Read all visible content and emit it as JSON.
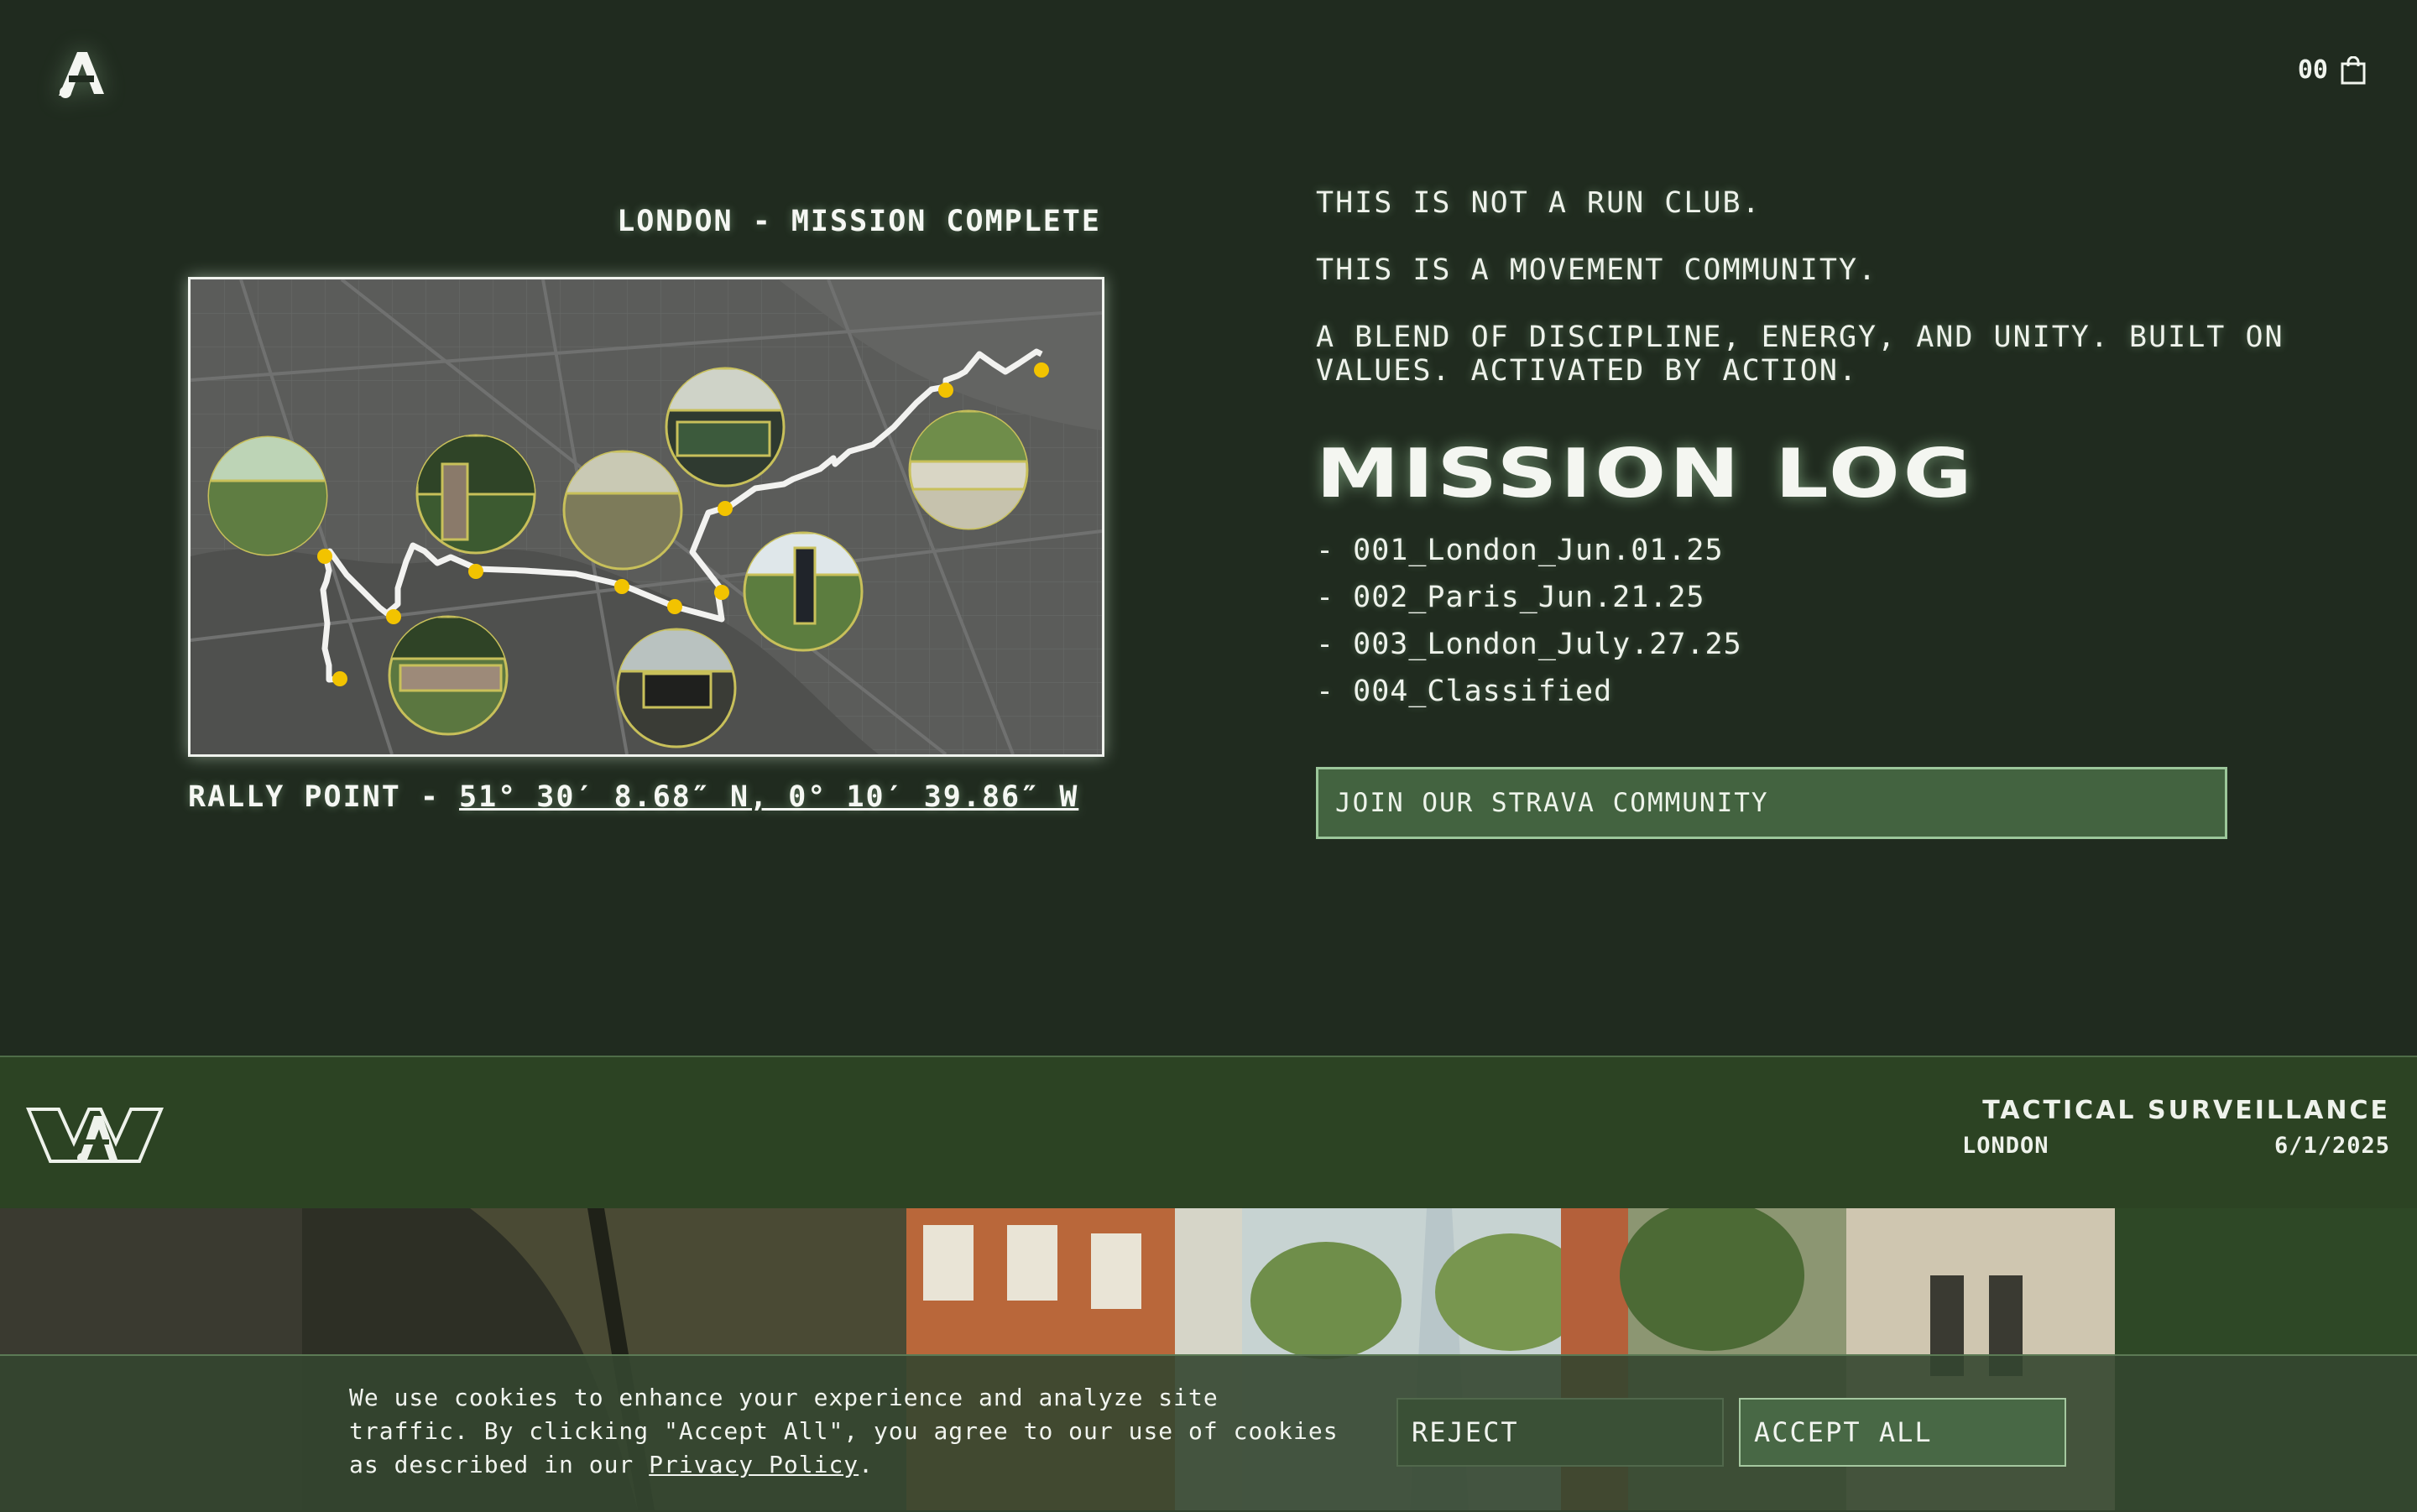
{
  "header": {
    "logo_icon": "brand-a-logo",
    "cart_count": "00",
    "cart_icon": "shopping-bag-icon"
  },
  "mission": {
    "title": "LONDON - MISSION COMPLETE",
    "rally_label": "RALLY POINT - ",
    "rally_coords": "51° 30′ 8.68″ N, 0° 10′ 39.86″ W"
  },
  "intro": {
    "line1": "THIS IS NOT A RUN CLUB.",
    "line2": "THIS IS A MOVEMENT COMMUNITY.",
    "line3": "A BLEND OF DISCIPLINE, ENERGY, AND UNITY. BUILT ON VALUES. ACTIVATED BY ACTION."
  },
  "mission_log": {
    "title": "MISSION LOG",
    "items": [
      "- 001_London_Jun.01.25",
      "- 002_Paris_Jun.21.25",
      "- 003_London_July.27.25",
      "- 004_Classified"
    ]
  },
  "strava_button": "JOIN OUR STRAVA COMMUNITY",
  "surveillance": {
    "logo_icon": "brand-wide-logo",
    "title": "TACTICAL SURVEILLANCE",
    "city": "LONDON",
    "date": "6/1/2025"
  },
  "cookie": {
    "text_before": "We use cookies to enhance your experience and analyze site traffic. By clicking \"Accept All\", you agree to our use of cookies as described in our ",
    "policy_link": "Privacy Policy",
    "text_after": ".",
    "reject": "REJECT",
    "accept": "ACCEPT ALL"
  },
  "colors": {
    "background": "#202b1f",
    "band": "#2c4323",
    "accent_button": "#436340",
    "route_marker": "#f2c300"
  }
}
